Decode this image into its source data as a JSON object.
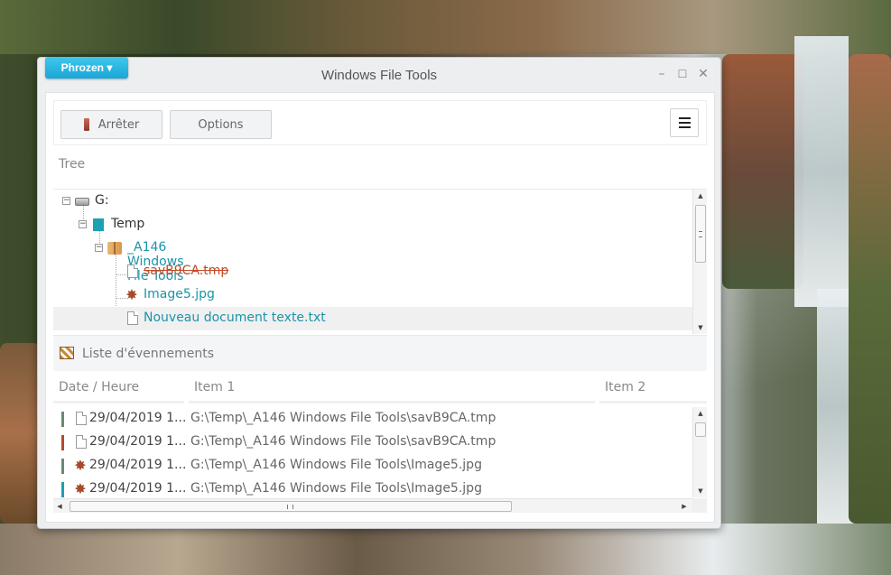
{
  "brand": {
    "label": "Phrozen ▾"
  },
  "window": {
    "title": "Windows File Tools",
    "controls": {
      "minimize": "–",
      "maximize": "☐",
      "close": "✕"
    }
  },
  "toolbar": {
    "stop_label": "Arrêter",
    "options_label": "Options"
  },
  "tree": {
    "label": "Tree",
    "nodes": [
      {
        "label": "G:",
        "icon": "drive-icon",
        "style": "dark"
      },
      {
        "label": "Temp",
        "icon": "folder-icon",
        "style": "dark"
      },
      {
        "label": "_A146 Windows File Tools",
        "icon": "zip-folder-icon",
        "style": "teal"
      },
      {
        "label": "savB9CA.tmp",
        "icon": "file-icon",
        "style": "deleted"
      },
      {
        "label": "Image5.jpg",
        "icon": "image-icon",
        "style": "teal"
      },
      {
        "label": "Nouveau document texte.txt",
        "icon": "file-icon",
        "style": "teal",
        "selected": true
      }
    ]
  },
  "events": {
    "label": "Liste d'évennements",
    "columns": [
      "Date / Heure",
      "Item 1",
      "Item 2"
    ],
    "rows": [
      {
        "bar_color": "#6a8a72",
        "icon": "file-icon",
        "date": "29/04/2019 1...",
        "item1": "G:\\Temp\\_A146 Windows File Tools\\savB9CA.tmp"
      },
      {
        "bar_color": "#b84a2a",
        "icon": "file-icon",
        "date": "29/04/2019 1...",
        "item1": "G:\\Temp\\_A146 Windows File Tools\\savB9CA.tmp"
      },
      {
        "bar_color": "#6a8a72",
        "icon": "image-icon",
        "date": "29/04/2019 1...",
        "item1": "G:\\Temp\\_A146 Windows File Tools\\Image5.jpg"
      },
      {
        "bar_color": "#1da0b0",
        "icon": "image-icon",
        "date": "29/04/2019 1...",
        "item1": "G:\\Temp\\_A146 Windows File Tools\\Image5.jpg"
      }
    ]
  },
  "colors": {
    "accent": "#1aa6d8",
    "teal_text": "#1a94a8",
    "deleted_text": "#c04a28"
  }
}
